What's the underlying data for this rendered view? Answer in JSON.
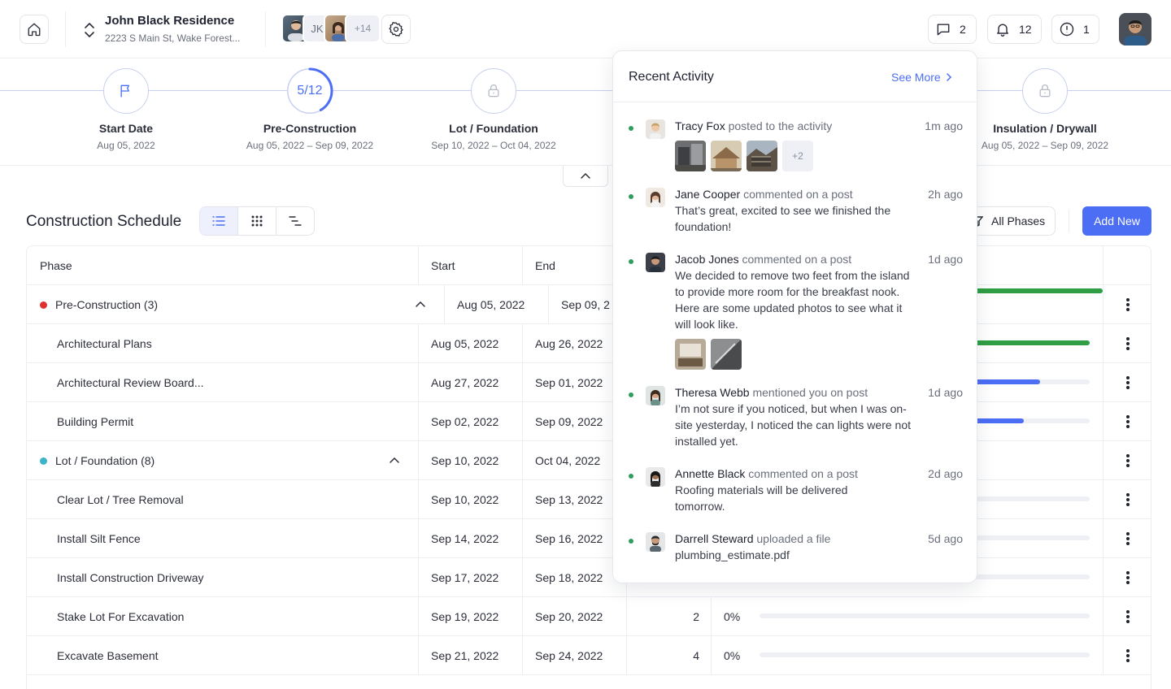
{
  "project": {
    "name": "John Black Residence",
    "address": "2223 S Main St, Wake Forest...",
    "member_initials": "JK",
    "member_more": "+14"
  },
  "header_badges": {
    "messages": "2",
    "notifications": "12",
    "alerts": "1"
  },
  "timeline": [
    {
      "label": "Start Date",
      "date": "Aug 05, 2022",
      "icon": "flag-icon"
    },
    {
      "label": "Pre-Construction",
      "date": "Aug 05, 2022 – Sep 09, 2022",
      "progress_text": "5/12",
      "progress": 0.4167
    },
    {
      "label": "Lot / Foundation",
      "date": "Sep 10, 2022 – Oct 04, 2022",
      "icon": "lock-icon"
    },
    {
      "label": "Insulation / Drywall",
      "date": "Aug 05, 2022 – Sep 09, 2022",
      "icon": "lock-icon"
    }
  ],
  "schedule": {
    "title": "Construction Schedule",
    "filter_label": "All Phases",
    "add_label": "Add New",
    "columns": {
      "phase": "Phase",
      "start": "Start",
      "end": "End"
    },
    "rows": [
      {
        "phase": "Pre-Construction (3)",
        "start": "Aug 05, 2022",
        "end": "Sep 09, 2",
        "group": true,
        "color": "#e03131",
        "progress": 1.0,
        "bar_color": "#2f9e44"
      },
      {
        "phase": "Architectural Plans",
        "start": "Aug 05, 2022",
        "end": "Aug 26, 2022",
        "progress": 1.0,
        "bar_color": "#2f9e44"
      },
      {
        "phase": "Architectural Review Board...",
        "start": "Aug 27, 2022",
        "end": "Sep 01, 2022",
        "progress": 0.85,
        "bar_color": "#4c6ef5"
      },
      {
        "phase": "Building Permit",
        "start": "Sep 02, 2022",
        "end": "Sep 09, 2022",
        "progress": 0.8,
        "bar_color": "#4c6ef5"
      },
      {
        "phase": "Lot / Foundation (8)",
        "start": "Sep 10, 2022",
        "end": "Oct 04, 2022",
        "group": true,
        "color": "#3bb4c9",
        "progress": 0
      },
      {
        "phase": "Clear Lot / Tree Removal",
        "start": "Sep 10, 2022",
        "end": "Sep 13, 2022",
        "progress": 0
      },
      {
        "phase": "Install Silt Fence",
        "start": "Sep 14, 2022",
        "end": "Sep 16, 2022",
        "progress": 0
      },
      {
        "phase": "Install Construction Driveway",
        "start": "Sep 17, 2022",
        "end": "Sep 18, 2022",
        "progress": 0
      },
      {
        "phase": "Stake Lot For Excavation",
        "start": "Sep 19, 2022",
        "end": "Sep 20, 2022",
        "duration": "2",
        "pct": "0%",
        "progress": 0
      },
      {
        "phase": "Excavate Basement",
        "start": "Sep 21, 2022",
        "end": "Sep 24, 2022",
        "duration": "4",
        "pct": "0%",
        "progress": 0
      }
    ]
  },
  "activity": {
    "title": "Recent Activity",
    "see_more": "See More",
    "items": [
      {
        "name": "Tracy Fox",
        "verb": "posted to the activity",
        "time": "1m ago",
        "thumbs_more": "+2"
      },
      {
        "name": "Jane Cooper",
        "verb": "commented on a post",
        "time": "2h ago",
        "body": "That’s great, excited to see we finished the foundation!"
      },
      {
        "name": "Jacob Jones",
        "verb": "commented on a post",
        "time": "1d ago",
        "body": "We decided to remove two feet from the island to provide more room for the breakfast nook.  Here are some updated photos to see what it will look like."
      },
      {
        "name": "Theresa Webb",
        "verb": "mentioned you on post",
        "time": "1d ago",
        "body": "I’m not sure if you noticed, but when I was on-site yesterday, I noticed the can lights were not installed yet."
      },
      {
        "name": "Annette Black",
        "verb": "commented on a post",
        "time": "2d ago",
        "body": "Roofing materials will be delivered tomorrow."
      },
      {
        "name": "Darrell Steward",
        "verb": "uploaded a file",
        "time": "5d ago",
        "body": "plumbing_estimate.pdf"
      }
    ]
  },
  "colors": {
    "accent": "#4c6ef5",
    "green": "#2f9e44",
    "dot_green": "#2f9e5a"
  }
}
